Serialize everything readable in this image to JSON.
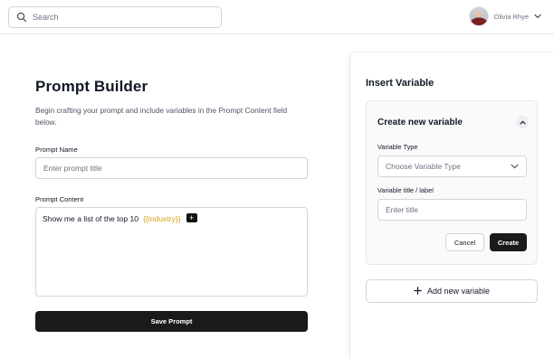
{
  "header": {
    "search": {
      "placeholder": "Search",
      "icon": "search-icon"
    },
    "user": {
      "name": "Olivia Rhye",
      "avatar_icon": "avatar"
    }
  },
  "builder": {
    "title": "Prompt Builder",
    "description": "Begin crafting your prompt and include variables in the Prompt Content field below.",
    "prompt_name_label": "Prompt Name",
    "prompt_name_placeholder": "Enter prompt title",
    "prompt_content_label": "Prompt Content",
    "prompt_content_text": "Show me a list of the top 10",
    "prompt_content_variable": "{{industry}}",
    "insert_chip_label": "+",
    "save_label": "Save Prompt"
  },
  "insert_panel": {
    "title": "Insert Variable",
    "card_title": "Create new variable",
    "variable_type_label": "Variable Type",
    "variable_type_placeholder": "Choose Variable Type",
    "variable_title_label": "Variable title / label",
    "variable_title_placeholder": "Enter title",
    "cancel_label": "Cancel",
    "create_label": "Create",
    "add_new_label": "Add new variable",
    "add_new_icon": "plus-icon"
  },
  "colors": {
    "primary": "#1a1a1a",
    "variable_token": "#d4a017",
    "border": "#d1d5db"
  }
}
